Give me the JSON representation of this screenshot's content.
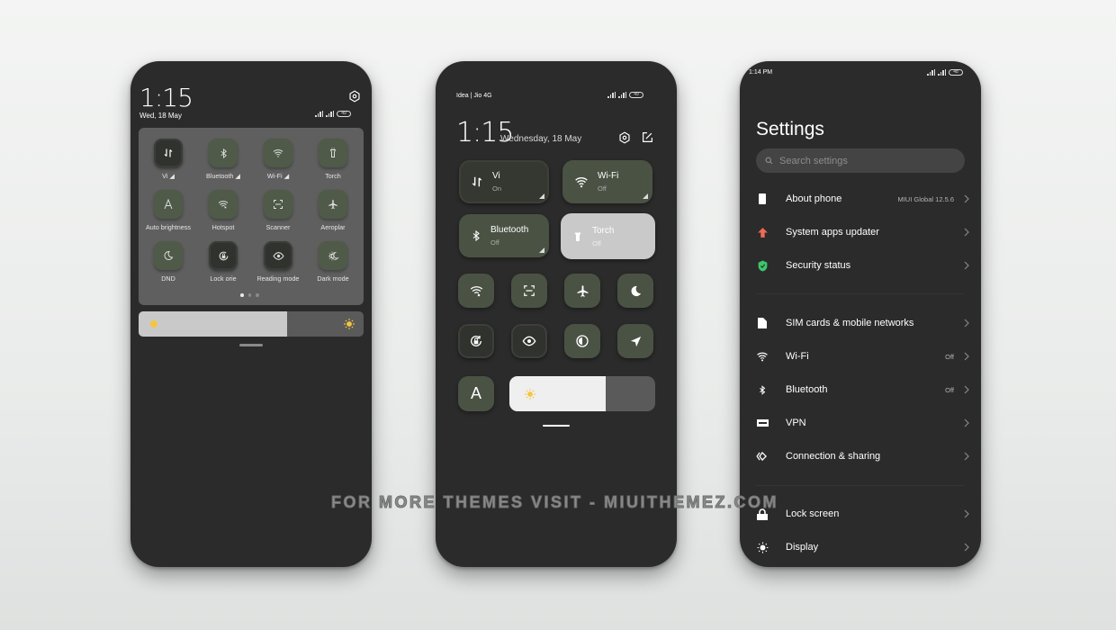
{
  "phone1": {
    "clock": "1:15",
    "date": "Wed, 18 May",
    "battery": "49",
    "tiles": [
      {
        "label": "Vi ◢",
        "icon": "mobile-data-icon",
        "active": true
      },
      {
        "label": "Bluetooth ◢",
        "icon": "bluetooth-icon",
        "active": false
      },
      {
        "label": "Wi-Fi ◢",
        "icon": "wifi-icon",
        "active": false
      },
      {
        "label": "Torch",
        "icon": "torch-icon",
        "active": false
      },
      {
        "label": "Auto brightness",
        "icon": "auto-brightness-icon",
        "active": false
      },
      {
        "label": "Hotspot",
        "icon": "hotspot-icon",
        "active": false
      },
      {
        "label": "Scanner",
        "icon": "scanner-icon",
        "active": false
      },
      {
        "label": "Aeroplar",
        "icon": "airplane-icon",
        "active": false
      },
      {
        "label": "DND",
        "icon": "moon-icon",
        "active": false
      },
      {
        "label": "Lock orie",
        "icon": "rotation-lock-icon",
        "active": true
      },
      {
        "label": "Reading mode",
        "icon": "eye-icon",
        "active": true
      },
      {
        "label": "Dark mode",
        "icon": "dark-mode-icon",
        "active": false
      }
    ],
    "page_indicator": {
      "pages": 3,
      "current": 1
    },
    "brightness_percent": 66
  },
  "phone2": {
    "carrier": "Idea | Jio 4G",
    "battery": "49",
    "clock": "1:15",
    "date": "Wednesday, 18 May",
    "big_tiles": [
      {
        "name": "Vi",
        "state": "On",
        "icon": "mobile-data-icon"
      },
      {
        "name": "Wi-Fi",
        "state": "Off",
        "icon": "wifi-icon"
      },
      {
        "name": "Bluetooth",
        "state": "Off",
        "icon": "bluetooth-icon"
      },
      {
        "name": "Torch",
        "state": "Off",
        "icon": "torch-icon"
      }
    ],
    "small_tiles": [
      {
        "icon": "hotspot-icon"
      },
      {
        "icon": "scanner-icon"
      },
      {
        "icon": "airplane-icon"
      },
      {
        "icon": "moon-icon"
      },
      {
        "icon": "rotation-lock-icon"
      },
      {
        "icon": "eye-icon"
      },
      {
        "icon": "contrast-icon"
      },
      {
        "icon": "location-icon"
      }
    ],
    "auto_brightness_label": "A",
    "brightness_percent": 66
  },
  "phone3": {
    "time": "1:14 PM",
    "battery": "48",
    "title": "Settings",
    "search_placeholder": "Search settings",
    "items": [
      {
        "label": "About phone",
        "value": "MIUI Global 12.5.6",
        "icon": "phone-icon"
      },
      {
        "label": "System apps updater",
        "value": "",
        "icon": "update-arrow-icon"
      },
      {
        "label": "Security status",
        "value": "",
        "icon": "shield-icon"
      },
      {
        "label": "SIM cards & mobile networks",
        "value": "",
        "icon": "sim-card-icon"
      },
      {
        "label": "Wi-Fi",
        "value": "Off",
        "icon": "wifi-icon"
      },
      {
        "label": "Bluetooth",
        "value": "Off",
        "icon": "bluetooth-icon"
      },
      {
        "label": "VPN",
        "value": "",
        "icon": "vpn-icon"
      },
      {
        "label": "Connection & sharing",
        "value": "",
        "icon": "connection-sharing-icon"
      },
      {
        "label": "Lock screen",
        "value": "",
        "icon": "lock-icon"
      },
      {
        "label": "Display",
        "value": "",
        "icon": "display-sun-icon"
      }
    ]
  },
  "watermark": "FOR MORE THEMES VISIT - MIUITHEMEZ.COM",
  "colors": {
    "tile_green": "#4a5244",
    "update_red": "#f06a55",
    "security_green": "#3ec46d",
    "sun_yellow": "#f5c542"
  }
}
